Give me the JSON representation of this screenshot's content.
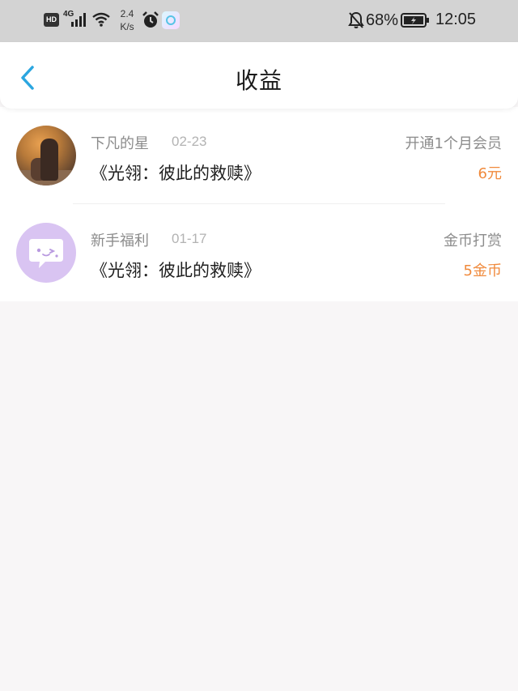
{
  "status_bar": {
    "hd_label": "HD",
    "network_label": "4G",
    "speed_value": "2.4",
    "speed_unit": "K/s",
    "battery_percent": "68%",
    "time": "12:05"
  },
  "header": {
    "title": "收益",
    "back_icon": "chevron-left-icon"
  },
  "colors": {
    "accent_blue": "#2ba6e0",
    "amount_orange": "#f08a3c",
    "bot_avatar_bg": "#d9c4f2"
  },
  "earnings": [
    {
      "name": "下凡的星",
      "date": "02-23",
      "book": "《光翎：彼此的救赎》",
      "type": "开通1个月会员",
      "amount": "6元",
      "avatar": "photo-avatar"
    },
    {
      "name": "新手福利",
      "date": "01-17",
      "book": "《光翎：彼此的救赎》",
      "type": "金币打赏",
      "amount": "5金币",
      "avatar": "chat-bubble-avatar"
    }
  ]
}
